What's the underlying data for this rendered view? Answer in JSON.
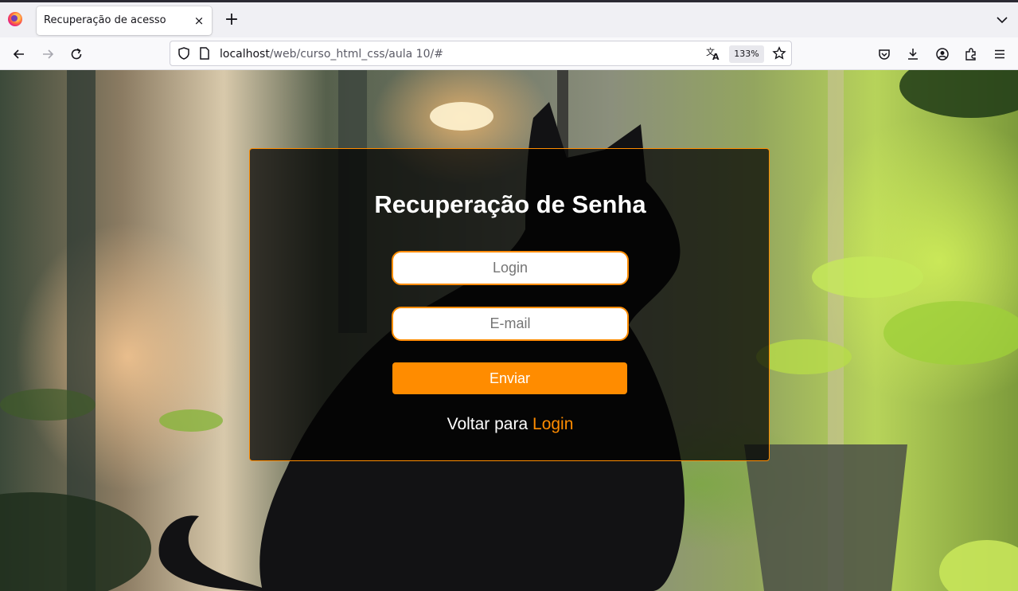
{
  "browser": {
    "tab_title": "Recuperação de acesso",
    "tab_close": "×",
    "new_tab": "+",
    "url_host": "localhost",
    "url_path": "/web/curso_html_css/aula 10/#",
    "zoom": "133%",
    "icons": [
      "firefox-icon",
      "back-icon",
      "forward-icon",
      "reload-icon",
      "shield-icon",
      "page-icon",
      "translate-icon",
      "star-icon",
      "pocket-icon",
      "download-icon",
      "account-icon",
      "extensions-icon",
      "menu-icon",
      "tab-list-icon"
    ]
  },
  "form": {
    "title": "Recuperação de Senha",
    "login_placeholder": "Login",
    "email_placeholder": "E-mail",
    "submit_label": "Enviar",
    "back_text": "Voltar para",
    "back_link": "Login"
  },
  "colors": {
    "accent": "#ff8c00",
    "card_background": "rgba(0,0,0,0.72)"
  }
}
